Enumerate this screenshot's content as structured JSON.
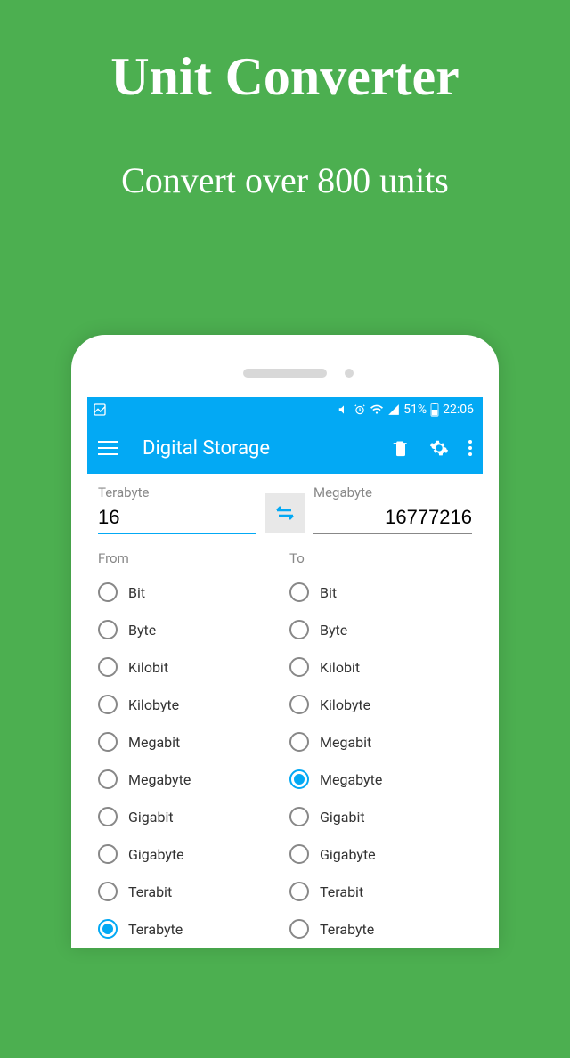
{
  "promo": {
    "title": "Unit Converter",
    "subtitle": "Convert  over 800 units"
  },
  "status": {
    "battery_text": "51%",
    "time": "22:06"
  },
  "app": {
    "title": "Digital Storage"
  },
  "inputs": {
    "from_label": "Terabyte",
    "from_value": "16",
    "to_label": "Megabyte",
    "to_value": "16777216"
  },
  "columns": {
    "from_label": "From",
    "to_label": "To"
  },
  "units": {
    "from": [
      {
        "label": "Bit",
        "selected": false
      },
      {
        "label": "Byte",
        "selected": false
      },
      {
        "label": "Kilobit",
        "selected": false
      },
      {
        "label": "Kilobyte",
        "selected": false
      },
      {
        "label": "Megabit",
        "selected": false
      },
      {
        "label": "Megabyte",
        "selected": false
      },
      {
        "label": "Gigabit",
        "selected": false
      },
      {
        "label": "Gigabyte",
        "selected": false
      },
      {
        "label": "Terabit",
        "selected": false
      },
      {
        "label": "Terabyte",
        "selected": true
      }
    ],
    "to": [
      {
        "label": "Bit",
        "selected": false
      },
      {
        "label": "Byte",
        "selected": false
      },
      {
        "label": "Kilobit",
        "selected": false
      },
      {
        "label": "Kilobyte",
        "selected": false
      },
      {
        "label": "Megabit",
        "selected": false
      },
      {
        "label": "Megabyte",
        "selected": true
      },
      {
        "label": "Gigabit",
        "selected": false
      },
      {
        "label": "Gigabyte",
        "selected": false
      },
      {
        "label": "Terabit",
        "selected": false
      },
      {
        "label": "Terabyte",
        "selected": false
      }
    ]
  }
}
